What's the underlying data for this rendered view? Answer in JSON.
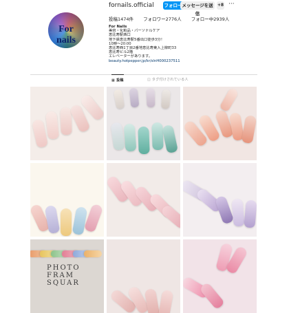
{
  "profile": {
    "username": "fornails.official",
    "follow_label": "フォローする",
    "message_label": "メッセージを送信",
    "suggest_label": "+8",
    "more_label": "···",
    "avatar_text": "For nails",
    "stats": {
      "posts": "投稿1474件",
      "followers": "フォロワー2776人",
      "following": "フォロー中2939人"
    },
    "bio": {
      "name": "For Nails",
      "line1": "美容・化粧品・パーソナルケア",
      "line2": "恵比寿駅西口",
      "line3": "地下鉄恵比寿駅5番出口徒歩3分！",
      "line4": "10時～20:00",
      "line5": "恵比寿西1丁目2番地恵比寿東入上柳町33",
      "line6": "恵比寿ビル2階",
      "line7": "エレベーターがあります。",
      "link": "beauty.hotpepper.jp/kr/slnH000237511"
    }
  },
  "tabs": [
    {
      "label": "投稿",
      "icon": "grid-icon"
    },
    {
      "label": "タグ付けされている人",
      "icon": "tag-icon"
    }
  ],
  "grid": {
    "posts": [
      {
        "name": "post-1",
        "bg": "#f4ede9"
      },
      {
        "name": "post-2",
        "bg": "#ebe7e8"
      },
      {
        "name": "post-3",
        "bg": "#f1e6e3"
      },
      {
        "name": "post-4",
        "bg": "#fbf7ee"
      },
      {
        "name": "post-5",
        "bg": "#f2ebe8"
      },
      {
        "name": "post-6",
        "bg": "#f3eef0"
      },
      {
        "name": "post-7",
        "bg": "#dcd7d2",
        "caption": "PHOTO FRAM SQUAR"
      },
      {
        "name": "post-8",
        "bg": "#efe6e4"
      },
      {
        "name": "post-9",
        "bg": "#f2e3e8"
      }
    ]
  }
}
